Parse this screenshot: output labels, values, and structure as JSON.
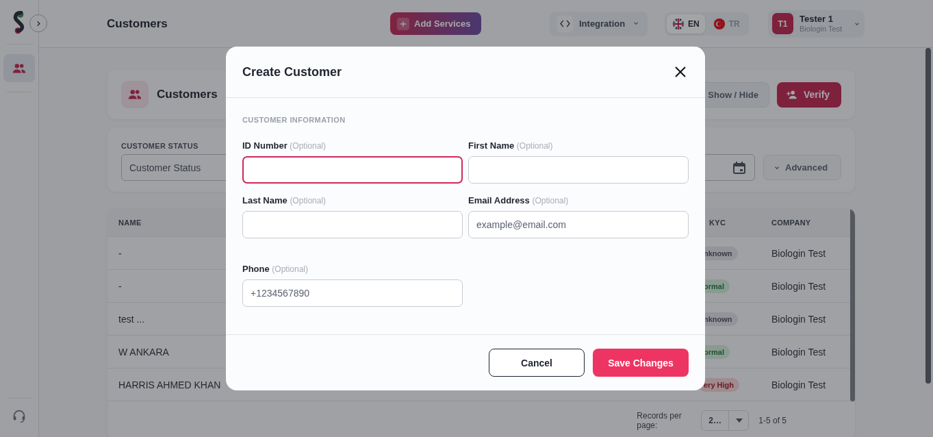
{
  "sidebar": {
    "items": [
      {
        "selected": true
      }
    ]
  },
  "topbar": {
    "title": "Customers",
    "add_services": "Add Services",
    "integration": "Integration",
    "languages": [
      {
        "code": "EN",
        "selected": true
      },
      {
        "code": "TR",
        "selected": false
      }
    ],
    "user": {
      "initials": "T1",
      "name": "Tester 1",
      "company": "Biologin Test"
    }
  },
  "page": {
    "card_title": "Customers",
    "show_hide": "Show / Hide",
    "verify": "Verify",
    "filters": {
      "status_label": "CUSTOMER STATUS",
      "status_placeholder": "Customer Status",
      "advanced": "Advanced"
    },
    "table": {
      "columns": [
        "NAME",
        "KYC",
        "COMPANY"
      ],
      "rows": [
        {
          "name": "-",
          "kyc": {
            "text": "nknown",
            "kind": "unknown"
          },
          "company": "Biologin Test"
        },
        {
          "name": "-",
          "kyc": {
            "text": "ormal",
            "kind": "normal"
          },
          "company": "Biologin Test"
        },
        {
          "name": "test ...",
          "kyc": {
            "text": "nknown",
            "kind": "unknown"
          },
          "company": "Biologin Test"
        },
        {
          "name": "W ANKARA",
          "kyc": {
            "text": "ormal",
            "kind": "normal"
          },
          "company": "Biologin Test"
        },
        {
          "name": "HARRIS AHMED KHAN",
          "kyc": {
            "text": "ery High",
            "kind": "very-high"
          },
          "company": "Biologin Test"
        }
      ]
    },
    "pagination": {
      "records_label": "Records per page:",
      "page_size": "2…",
      "range": "1-5 of 5"
    }
  },
  "modal": {
    "title": "Create Customer",
    "section": "CUSTOMER INFORMATION",
    "fields": [
      {
        "label": "ID Number",
        "hint": "(Optional)",
        "focused": true
      },
      {
        "label": "First Name",
        "hint": "(Optional)",
        "focused": false
      },
      {
        "label": "Last Name",
        "hint": "(Optional)",
        "focused": false
      },
      {
        "label": "Email Address",
        "hint": "(Optional)",
        "placeholder": "example@email.com",
        "focused": false
      },
      {
        "label": "Phone",
        "hint": "(Optional)",
        "placeholder": "+1234567890",
        "focused": false
      }
    ],
    "buttons": [
      {
        "label": "Cancel",
        "kind": "secondary"
      },
      {
        "label": "Save Changes",
        "kind": "primary"
      }
    ]
  }
}
